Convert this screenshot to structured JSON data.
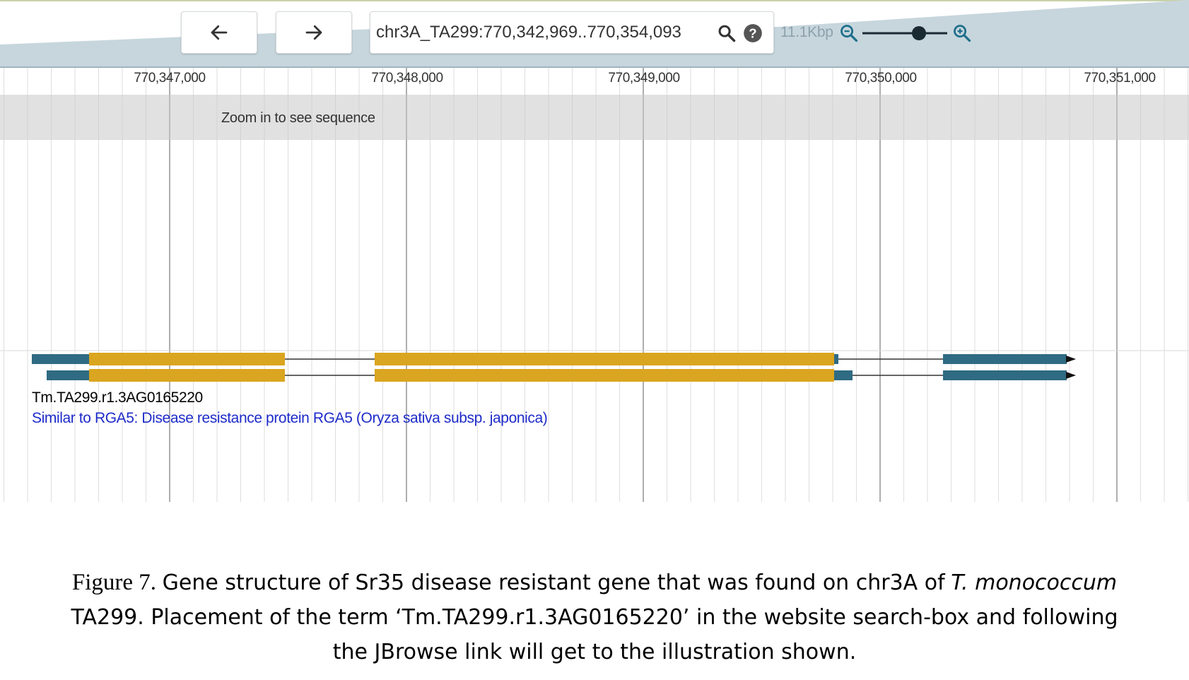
{
  "toolbar": {
    "back_icon": "arrow-left-icon",
    "forward_icon": "arrow-right-icon",
    "location_value": "chr3A_TA299:770,342,969..770,354,093",
    "search_icon": "search-icon",
    "help_icon": "help-circle-icon",
    "zoom_level": "11.1Kbp",
    "zoom_out_icon": "zoom-out-icon",
    "zoom_in_icon": "zoom-in-icon",
    "zoom_slider_level": 0.7
  },
  "ruler": {
    "labels": [
      "770,347,000",
      "770,348,000",
      "770,349,000",
      "770,350,000",
      "770,351,000"
    ]
  },
  "sequence_track": {
    "message": "Zoom in to see sequence"
  },
  "feature": {
    "name": "Tm.TA299.r1.3AG0165220",
    "description": "Similar to RGA5: Disease resistance protein RGA5 (Oryza sativa subsp. japonica)"
  },
  "caption": {
    "figure_label": "Figure 7.",
    "text": "Gene structure of Sr35 disease resistant gene that was found on chr3A of",
    "species": "T. monococcum",
    "rest": "TA299. Placement of the term ‘Tm.TA299.r1.3AG0165220’ in the website search-box and following the JBrowse link will get to the illustration shown."
  },
  "colors": {
    "nav_band": "#c7d6dd",
    "cds": "#daa520",
    "utr": "#2f6b82",
    "link": "#1e2bc9"
  }
}
